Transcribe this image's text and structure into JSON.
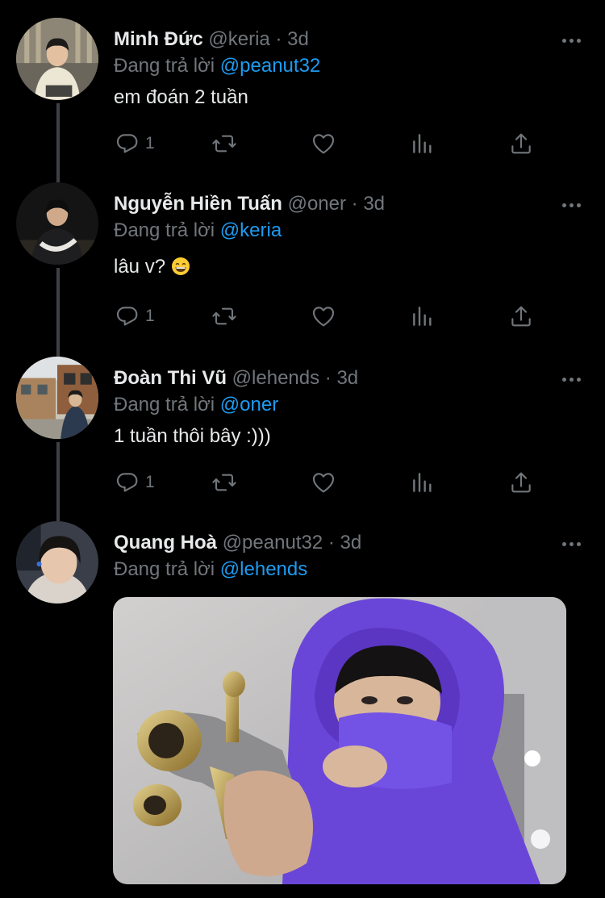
{
  "reply_prefix": "Đang trả lời",
  "dot_sep": "·",
  "tweets": [
    {
      "name": "Minh Đức",
      "handle": "@keria",
      "time": "3d",
      "reply_to": "@peanut32",
      "text": "em đoán 2 tuần",
      "reply_count": "1"
    },
    {
      "name": "Nguyễn Hiền Tuấn",
      "handle": "@oner",
      "time": "3d",
      "reply_to": "@keria",
      "text": "lâu v?",
      "text_emoji": "grinning-face-with-smiling-eyes",
      "reply_count": "1"
    },
    {
      "name": "Đoàn Thi Vũ",
      "handle": "@lehends",
      "time": "3d",
      "reply_to": "@oner",
      "text": "1 tuần thôi bây :)))",
      "reply_count": "1"
    },
    {
      "name": "Quang Hoà",
      "handle": "@peanut32",
      "time": "3d",
      "reply_to": "@lehends",
      "media": "photo-person-in-purple-hood-holding-gun"
    }
  ],
  "icons": {
    "reply": "reply-icon",
    "retweet": "retweet-icon",
    "like": "heart-icon",
    "analytics": "analytics-icon",
    "share": "share-icon",
    "more": "more-icon"
  },
  "colors": {
    "background": "#000000",
    "text": "#e7e9ea",
    "muted": "#71767b",
    "accent": "#1d9bf0",
    "thread_line": "#3d4147"
  }
}
